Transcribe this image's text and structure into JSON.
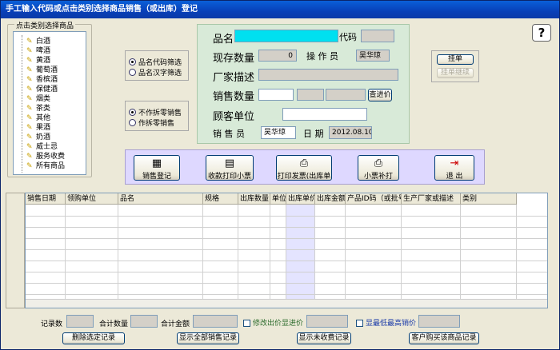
{
  "window": {
    "title": "手工输入代码或点击类别选择商品销售（或出库）登记"
  },
  "tree": {
    "group_label": "点击类别选择商品",
    "items": [
      "白酒",
      "啤酒",
      "黄酒",
      "葡萄酒",
      "香槟酒",
      "保健酒",
      "烟类",
      "茶类",
      "其他",
      "果酒",
      "奶酒",
      "威士忌",
      "服务收费",
      "所有商品"
    ]
  },
  "filter": {
    "opt1": "品名代码筛选",
    "opt2": "品名汉字筛选",
    "opt3": "不作拆零销售",
    "opt4": "作拆零销售"
  },
  "form": {
    "name_label": "品名",
    "code_label": "代码",
    "code_value": "",
    "stock_label": "现存数量",
    "stock_value": "0",
    "operator_label": "操 作 员",
    "operator_value": "吴华琼",
    "desc_label": "厂家描述",
    "qty_label": "销售数量",
    "check_price_btn": "查进价",
    "customer_label": "顾客单位",
    "seller_label": "销 售 员",
    "seller_value": "吴华琼",
    "date_label": "日 期",
    "date_value": "2012.08.10"
  },
  "side": {
    "hang_btn": "挂单",
    "resume_btn": "挂单继续"
  },
  "toolbar": {
    "b1": "销售登记",
    "b2": "收款打印小票",
    "b3": "打印发票(出库单",
    "b4": "小票补打",
    "b5": "退 出"
  },
  "grid": {
    "columns": [
      "销售日期",
      "领购单位",
      "品名",
      "规格",
      "出库数量",
      "单位",
      "出库单价",
      "出库金额",
      "产品ID码（或批号）",
      "生产厂家或描述",
      "类别"
    ]
  },
  "bottom": {
    "rec_count": "记录数",
    "total_qty": "合计数量",
    "total_amt": "合计金额",
    "chk1": "修改出价显进价",
    "chk2": "显最低最高销价",
    "btn_del": "删除选定记录",
    "btn_all": "显示全部销售记录",
    "btn_unpaid": "显示未收费记录",
    "btn_cust": "客户购买该商品记录"
  }
}
